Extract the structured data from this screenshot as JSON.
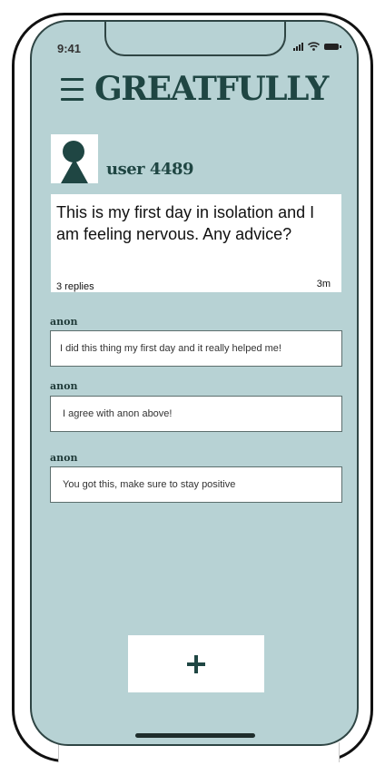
{
  "status_bar": {
    "time": "9:41",
    "icons": [
      "cellular-signal-icon",
      "wifi-icon",
      "battery-icon"
    ]
  },
  "header": {
    "menu_icon": "hamburger-menu-icon",
    "title": "GREATFULLY"
  },
  "profile": {
    "avatar_icon": "user-silhouette-icon",
    "username": "user 4489"
  },
  "post": {
    "text": "This is my first day in isolation and I am feeling nervous. Any advice?",
    "replies": "3 replies",
    "time": "3m"
  },
  "replies": [
    {
      "author": "anon",
      "text": "I did this thing my first day and it really helped me!"
    },
    {
      "author": "anon",
      "text": "I agree with anon above!"
    },
    {
      "author": "anon",
      "text": "You got this, make sure to stay positive"
    }
  ],
  "actions": {
    "add_icon": "plus-icon"
  },
  "colors": {
    "background": "#b7d2d4",
    "accent": "#1f4643",
    "card": "#ffffff"
  }
}
